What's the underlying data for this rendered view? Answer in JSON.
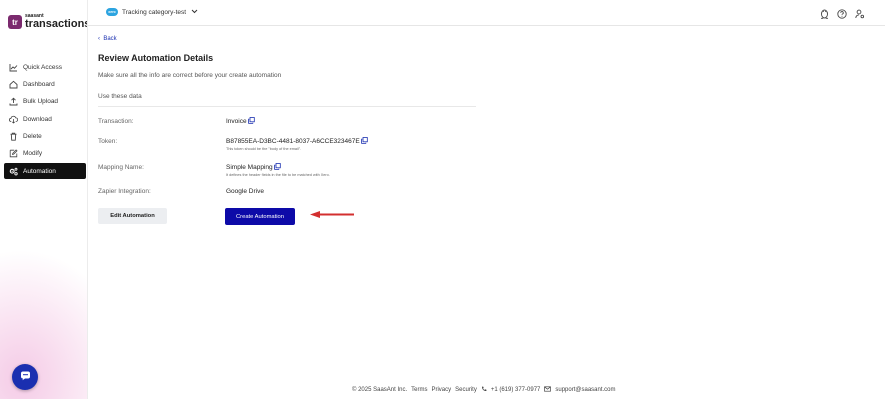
{
  "app": {
    "logo_mark": "tr",
    "logo_small": "saasant",
    "logo_big": "transactions"
  },
  "sidebar": {
    "items": [
      {
        "label": "Quick Access",
        "icon": "chart-icon"
      },
      {
        "label": "Dashboard",
        "icon": "home-icon"
      },
      {
        "label": "Bulk Upload",
        "icon": "upload-icon"
      },
      {
        "label": "Download",
        "icon": "cloud-download-icon"
      },
      {
        "label": "Delete",
        "icon": "trash-icon"
      },
      {
        "label": "Modify",
        "icon": "edit-icon"
      },
      {
        "label": "Automation",
        "icon": "gears-icon",
        "active": true
      }
    ]
  },
  "topbar": {
    "company_logo": "xero",
    "company_name": "Tracking category-test"
  },
  "main": {
    "back_label": "Back",
    "title": "Review Automation Details",
    "subtitle": "Make sure all the info are correct before your create automation",
    "section_heading": "Use these data",
    "rows": {
      "transaction": {
        "label": "Transaction:",
        "value": "Invoice"
      },
      "token": {
        "label": "Token:",
        "value": "B87855EA-D3BC-4481-8037-A6CCE323467E",
        "note": "This token should be the \"body of the email\"."
      },
      "mapping": {
        "label": "Mapping Name:",
        "value": "Simple Mapping",
        "note": "It defines the header fields in the file to be matched with Xero."
      },
      "zapier": {
        "label": "Zapier Integration:",
        "value": "Google Drive"
      }
    },
    "edit_button": "Edit Automation",
    "create_button": "Create Automation"
  },
  "footer": {
    "copyright": "© 2025 SaasAnt Inc.",
    "terms": "Terms",
    "privacy": "Privacy",
    "security": "Security",
    "phone": "+1 (619) 377-0977",
    "email": "support@saasant.com"
  },
  "colors": {
    "accent": "#1a2fb0",
    "primary_button": "#0d0aa8",
    "brand": "#7b2a6e",
    "arrow": "#d32f2f"
  }
}
